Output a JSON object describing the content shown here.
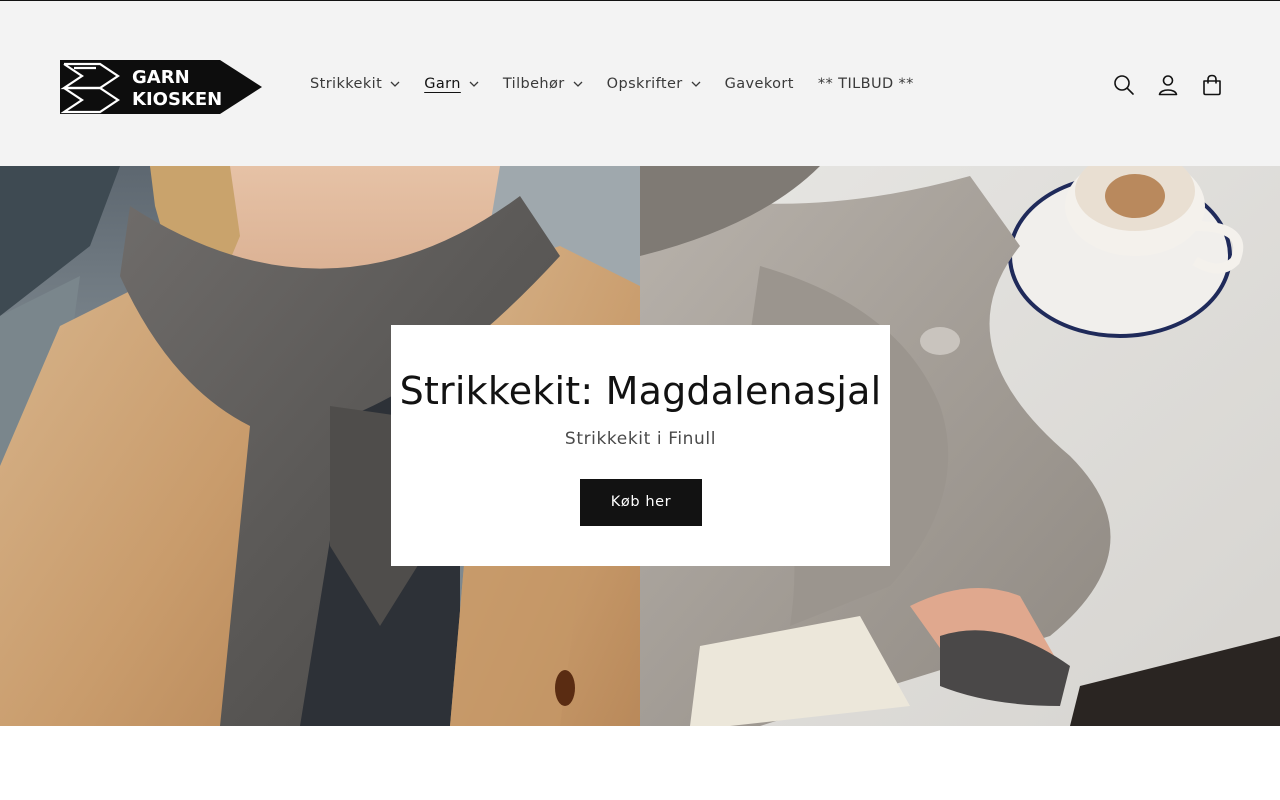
{
  "logo": {
    "line1": "GARN",
    "line2": "KIOSKEN"
  },
  "nav": {
    "items": [
      {
        "label": "Strikkekit",
        "dropdown": true
      },
      {
        "label": "Garn",
        "dropdown": true,
        "active": true
      },
      {
        "label": "Tilbehør",
        "dropdown": true
      },
      {
        "label": "Opskrifter",
        "dropdown": true
      },
      {
        "label": "Gavekort",
        "dropdown": false
      },
      {
        "label": "** TILBUD **",
        "dropdown": false
      }
    ]
  },
  "header_icons": [
    "search-icon",
    "account-icon",
    "cart-icon"
  ],
  "hero": {
    "title": "Strikkekit: Magdalenasjal",
    "subtitle": "Strikkekit i Finull",
    "button_label": "Køb her"
  },
  "next_section": {
    "heading": ""
  },
  "colors": {
    "header_bg": "#f3f3f3",
    "text": "#121212",
    "button_bg": "#121212",
    "button_text": "#ffffff"
  }
}
